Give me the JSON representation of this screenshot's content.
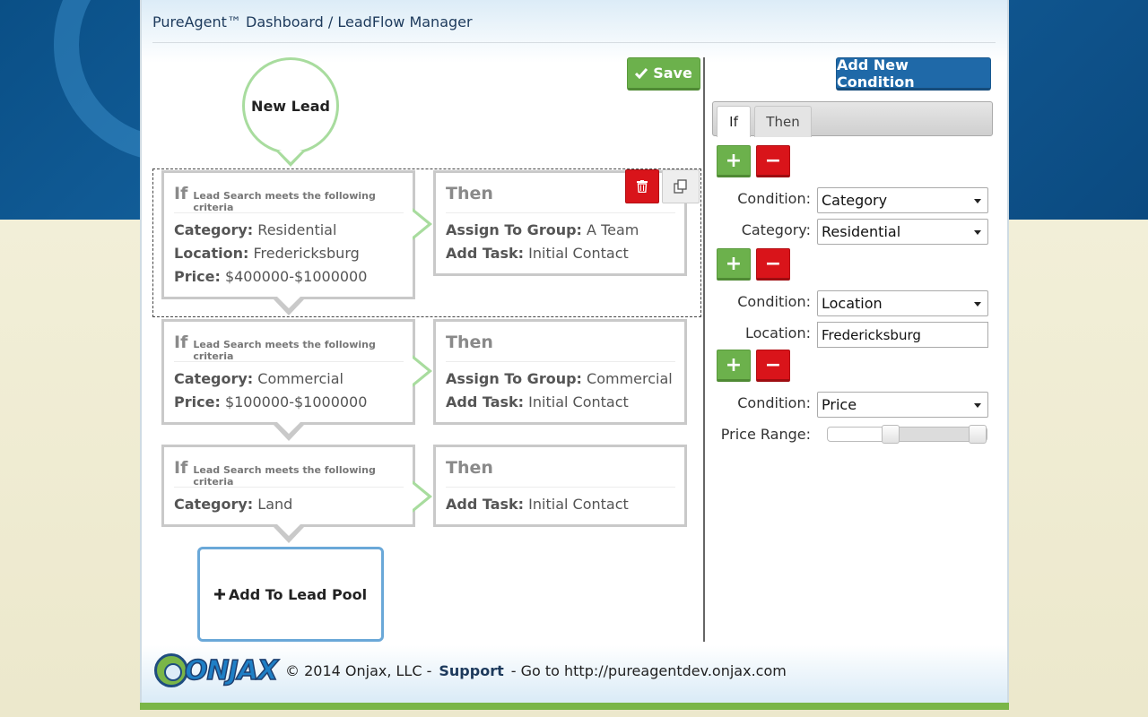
{
  "breadcrumb": "PureAgent™ Dashboard / LeadFlow Manager",
  "toolbar": {
    "save_label": "Save",
    "add_condition_label": "Add New Condition"
  },
  "start_node": {
    "label": "New Lead"
  },
  "rules": [
    {
      "if_title": "If",
      "if_subtitle": "Lead Search meets the following criteria",
      "conditions": [
        {
          "key": "Category:",
          "value": "Residential"
        },
        {
          "key": "Location:",
          "value": "Fredericksburg"
        },
        {
          "key": "Price:",
          "value": "$400000-$1000000"
        }
      ],
      "then_title": "Then",
      "actions": [
        {
          "key": "Assign To Group:",
          "value": "A Team"
        },
        {
          "key": "Add Task:",
          "value": "Initial Contact"
        }
      ]
    },
    {
      "if_title": "If",
      "if_subtitle": "Lead Search meets the following criteria",
      "conditions": [
        {
          "key": "Category:",
          "value": "Commercial"
        },
        {
          "key": "Price:",
          "value": "$100000-$1000000"
        }
      ],
      "then_title": "Then",
      "actions": [
        {
          "key": "Assign To Group:",
          "value": "Commercial"
        },
        {
          "key": "Add Task:",
          "value": "Initial Contact"
        }
      ]
    },
    {
      "if_title": "If",
      "if_subtitle": "Lead Search meets the following criteria",
      "conditions": [
        {
          "key": "Category:",
          "value": "Land"
        }
      ],
      "then_title": "Then",
      "actions": [
        {
          "key": "Add Task:",
          "value": "Initial Contact"
        }
      ]
    }
  ],
  "lead_pool": {
    "label": "Add To Lead Pool"
  },
  "editor": {
    "tabs": [
      {
        "label": "If",
        "active": true
      },
      {
        "label": "Then",
        "active": false
      }
    ],
    "groups": [
      {
        "condition_label": "Condition:",
        "condition_value": "Category",
        "field_label": "Category:",
        "field_value": "Residential",
        "field_type": "select"
      },
      {
        "condition_label": "Condition:",
        "condition_value": "Location",
        "field_label": "Location:",
        "field_value": "Fredericksburg",
        "field_type": "text"
      },
      {
        "condition_label": "Condition:",
        "condition_value": "Price",
        "field_label": "Price Range:",
        "field_type": "range",
        "range_low_fraction": 0.38,
        "range_high_fraction": 1.0
      }
    ],
    "plus_symbol": "+",
    "minus_symbol": "−"
  },
  "footer": {
    "logo_text": "ONJAX",
    "copyright": "© 2014 Onjax, LLC -",
    "support_label": "Support",
    "support_text": "- Go to http://pureagentdev.onjax.com"
  },
  "colors": {
    "green": "#6cb14c",
    "red": "#d9141a",
    "blue": "#1f69a8",
    "connector": "#a8dc9e"
  }
}
